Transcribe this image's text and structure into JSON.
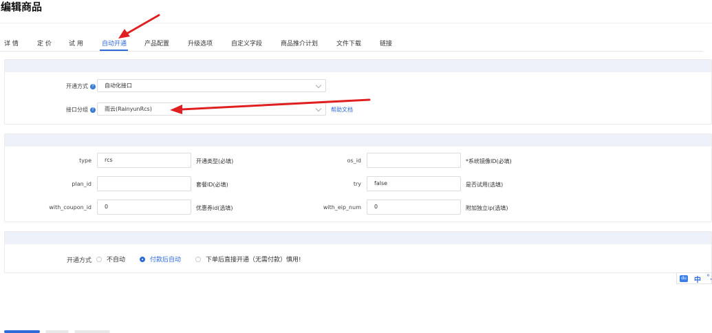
{
  "page": {
    "title": "编辑商品"
  },
  "tabs": [
    {
      "label": "详 情"
    },
    {
      "label": "定 价"
    },
    {
      "label": "试 用"
    },
    {
      "label": "自动开通"
    },
    {
      "label": "产品配置"
    },
    {
      "label": "升级选项"
    },
    {
      "label": "自定义字段"
    },
    {
      "label": "商品推介计划"
    },
    {
      "label": "文件下载"
    },
    {
      "label": "链接"
    }
  ],
  "active_tab": "自动开通",
  "section1": {
    "provision_method_label": "开通方式",
    "provision_method_value": "自动化接口",
    "interface_group_label": "接口分组",
    "interface_group_value": "雨云(RainyunRcs)",
    "help_link": "帮助文档"
  },
  "section2": {
    "fields": [
      {
        "label": "type",
        "value": "rcs",
        "hint": "开通类型(必填)"
      },
      {
        "label": "os_id",
        "value": "",
        "hint": "*系统镜像ID(必填)"
      },
      {
        "label": "plan_id",
        "value": "",
        "hint": "套餐ID(必填)"
      },
      {
        "label": "try",
        "value": "false",
        "hint": "是否试用(选填)"
      },
      {
        "label": "with_coupon_id",
        "value": "0",
        "hint": "优惠券id(选填)"
      },
      {
        "label": "with_eip_num",
        "value": "0",
        "hint": "附加独立ip(选填)"
      }
    ]
  },
  "section3": {
    "label": "开通方式",
    "options": [
      "不自动",
      "付款后自动",
      "下单后直接开通（无需付款）慎用!"
    ],
    "selected": "付款后自动"
  },
  "ime": {
    "lang": "中",
    "extra": "°,"
  },
  "colors": {
    "accent": "#2f6bd8",
    "arrow": "#e02020",
    "section_header": "#eef1fa"
  },
  "icons": [
    "help-icon",
    "chevron-down-icon",
    "ime-paw-icon"
  ]
}
